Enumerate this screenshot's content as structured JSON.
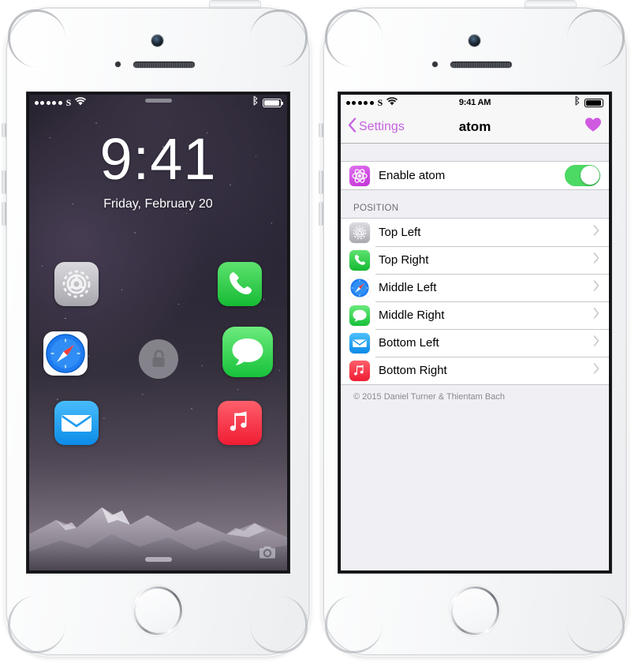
{
  "scene": {
    "description": "Two white iPhone 5s devices side by side: left shows iOS lock screen with app shortcuts, right shows the atom tweak settings page",
    "device_color": "#fbfbfc"
  },
  "left_phone": {
    "hardware": {
      "front_camera": "front-camera",
      "proximity_sensor": "proximity-sensor",
      "speaker": "earpiece-speaker",
      "home_button": "home-button",
      "mute_switch": "mute-switch",
      "volume_up": "volume-up-button",
      "volume_down": "volume-down-button",
      "power_button": "power-button"
    },
    "status_bar": {
      "signal_dots": 5,
      "carrier": "S",
      "wifi": "wifi-icon",
      "bluetooth": "bluetooth-icon",
      "battery": "battery-icon"
    },
    "lock_screen": {
      "time": "9:41",
      "date": "Friday, February 20",
      "unlock_icon": "unlock-icon",
      "camera_grabber": "camera-icon",
      "bottom_grabber": "bottom-grabber",
      "shortcuts": [
        {
          "name": "settings",
          "label": "Settings",
          "position": "top-left",
          "color": "#a8a8ad"
        },
        {
          "name": "phone",
          "label": "Phone",
          "position": "top-right",
          "color": "#4cd964"
        },
        {
          "name": "safari",
          "label": "Safari",
          "position": "middle-left",
          "color": "#1f7bf0"
        },
        {
          "name": "messages",
          "label": "Messages",
          "position": "middle-right",
          "color": "#4cd964"
        },
        {
          "name": "mail",
          "label": "Mail",
          "position": "bottom-left",
          "color": "#1d9bf5"
        },
        {
          "name": "music",
          "label": "Music",
          "position": "bottom-right",
          "color": "#fb3b4b"
        }
      ]
    }
  },
  "right_phone": {
    "status_bar": {
      "signal_dots": 5,
      "carrier": "S",
      "wifi": "wifi-icon",
      "time": "9:41 AM",
      "bluetooth": "bluetooth-icon",
      "battery": "battery-icon"
    },
    "navbar": {
      "back_label": "Settings",
      "back_icon": "chevron-left-icon",
      "title": "atom",
      "right_icon": "heart-icon",
      "tint": "#c661e0"
    },
    "enable_section": {
      "icon": "atom-icon",
      "icon_color": "#d44ce0",
      "label": "Enable atom",
      "toggle": {
        "state": "on",
        "color": "#4cd964"
      }
    },
    "position_section": {
      "header": "POSITION",
      "rows": [
        {
          "label": "Top Left",
          "icon": "settings-icon",
          "icon_color": "#a8a8ad",
          "accessory": "chevron-right-icon"
        },
        {
          "label": "Top Right",
          "icon": "phone-icon",
          "icon_color": "#4cd964",
          "accessory": "chevron-right-icon"
        },
        {
          "label": "Middle Left",
          "icon": "safari-icon",
          "icon_color": "#1f7bf0",
          "accessory": "chevron-right-icon"
        },
        {
          "label": "Middle Right",
          "icon": "messages-icon",
          "icon_color": "#4cd964",
          "accessory": "chevron-right-icon"
        },
        {
          "label": "Bottom Left",
          "icon": "mail-icon",
          "icon_color": "#1d9bf5",
          "accessory": "chevron-right-icon"
        },
        {
          "label": "Bottom Right",
          "icon": "music-icon",
          "icon_color": "#fb3b4b",
          "accessory": "chevron-right-icon"
        }
      ]
    },
    "footer": "© 2015 Daniel Turner & Thientam Bach"
  }
}
